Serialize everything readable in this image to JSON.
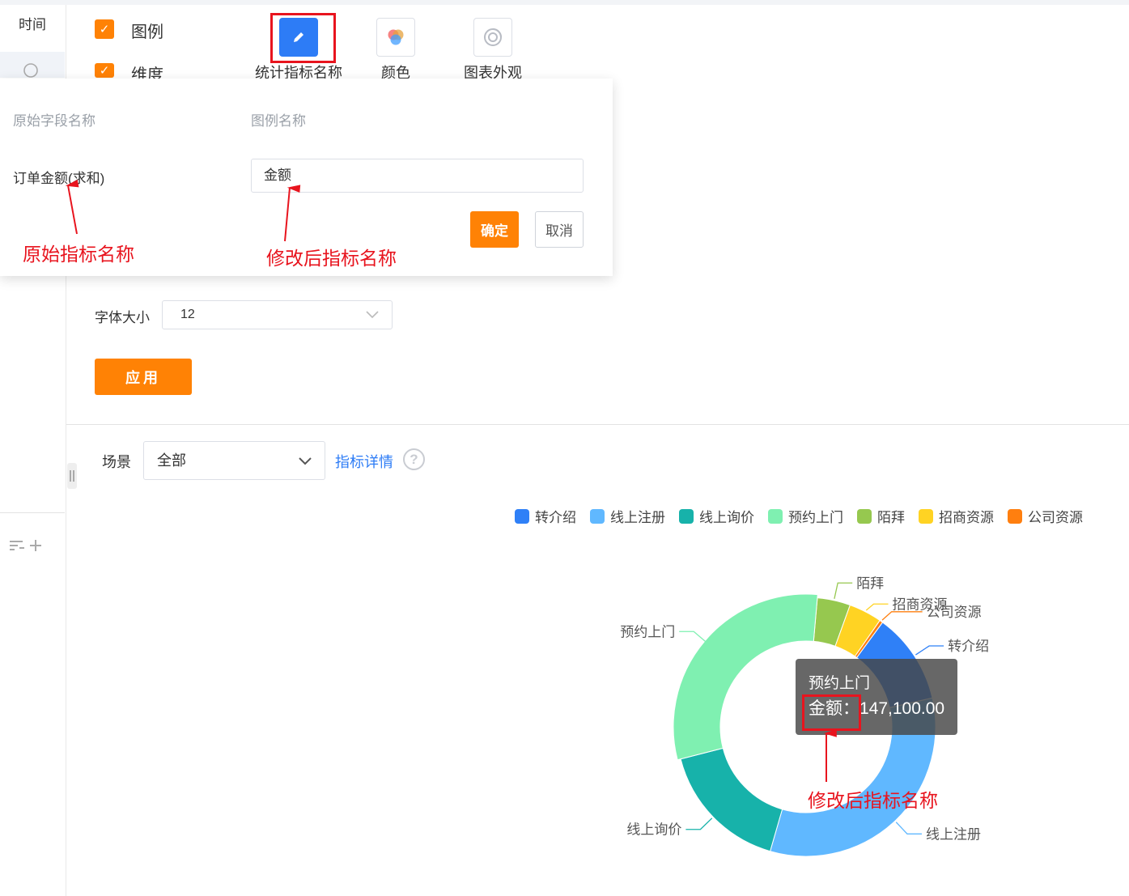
{
  "sidebar": {
    "time_label": "时间"
  },
  "options": {
    "legend_label": "图例",
    "dimension_label": "维度",
    "check_mark": "✓"
  },
  "toolbar": {
    "items": [
      {
        "label": "统计指标名称",
        "icon": "pencil-icon"
      },
      {
        "label": "颜色",
        "icon": "color-circles-icon"
      },
      {
        "label": "图表外观",
        "icon": "donut-appearance-icon"
      }
    ]
  },
  "popover": {
    "col_original": "原始字段名称",
    "col_legend": "图例名称",
    "original_field": "订单金额(求和)",
    "legend_name_value": "金额",
    "ok_label": "确定",
    "cancel_label": "取消"
  },
  "annotations": {
    "original": "原始指标名称",
    "modified": "修改后指标名称",
    "modified_chart": "修改后指标名称"
  },
  "font_size": {
    "label": "字体大小",
    "value": "12"
  },
  "apply_label": "应用",
  "scene": {
    "label": "场景",
    "value": "全部",
    "detail_link": "指标详情",
    "help": "?"
  },
  "colors": {
    "accent": "#ff8205",
    "primary": "#2d7cf6",
    "annotation": "#e8141e"
  },
  "chart_data": {
    "type": "pie",
    "variant": "donut",
    "legend_position": "top-right",
    "categories": [
      "转介绍",
      "线上注册",
      "线上询价",
      "预约上门",
      "陌拜",
      "招商资源",
      "公司资源"
    ],
    "colors": [
      "#2f80f7",
      "#60b8ff",
      "#17b2aa",
      "#7ff0b1",
      "#96c84f",
      "#ffd323",
      "#ff7f0f"
    ],
    "values": [
      55000,
      160000,
      80000,
      147100,
      20000,
      20000,
      2000
    ],
    "tooltip": {
      "category": "预约上门",
      "series_label": "金额：",
      "value_text": "147,100.00"
    }
  }
}
